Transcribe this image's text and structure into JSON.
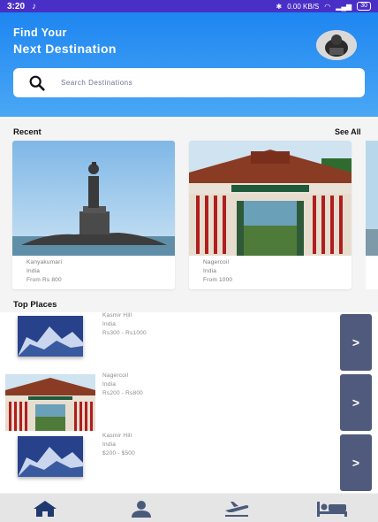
{
  "status_bar": {
    "time": "3:20",
    "note_icon": "music-note-icon",
    "net": "0.00 KB/S",
    "battery": "30"
  },
  "header": {
    "title_line1": "Find Your",
    "title_line2": "Next Destination",
    "avatar": "profile-avatar"
  },
  "search": {
    "placeholder": "Search Destinations"
  },
  "recent": {
    "title": "Recent",
    "see_all": "See All",
    "cards": [
      {
        "name": "Kanyakumari",
        "country": "India",
        "price": "From Rs 800",
        "image": "statue-on-rock-photo"
      },
      {
        "name": "Nagercoil",
        "country": "India",
        "price": "From 1000",
        "image": "palace-gate-photo"
      }
    ]
  },
  "top_places": {
    "title": "Top Places",
    "items": [
      {
        "name": "Kasmir Hill",
        "country": "India",
        "price": "Rs300 - Rs1000",
        "image": "mountain-photo",
        "arrow": ">"
      },
      {
        "name": "Nagercoil",
        "country": "India",
        "price": "Rs200 - Rs800",
        "image": "palace-gate-photo",
        "arrow": ">"
      },
      {
        "name": "Kasmir Hill",
        "country": "India",
        "price": "$200 - $500",
        "image": "mountain-photo",
        "arrow": ">"
      }
    ]
  },
  "bottom_nav": {
    "items": [
      "home-icon",
      "profile-icon",
      "flight-icon",
      "hotel-bed-icon"
    ],
    "active_color": "#1e3a6e",
    "inactive_color": "#4a5a7a"
  },
  "colors": {
    "header_top": "#1e86f1",
    "header_bottom": "#4aa7f5",
    "arrow_button": "#4f5a7c"
  }
}
